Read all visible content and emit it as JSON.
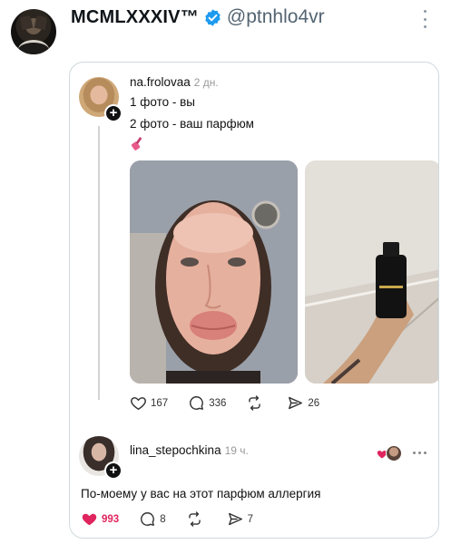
{
  "tweet": {
    "display_name": "MCMLXXXIV™",
    "handle": "@ptnhlo4vr"
  },
  "post": {
    "username": "na.frolovaa",
    "time": "2 дн.",
    "lines": [
      "1 фото - вы",
      "2 фото - ваш парфюм"
    ],
    "emoji_icon": "nail-polish-icon",
    "stats": {
      "likes": "167",
      "comments": "336",
      "reposts": "",
      "shares": "26"
    }
  },
  "reply": {
    "username": "lina_stepochkina",
    "time": "19 ч.",
    "text": "По-моему у вас на этот парфюм аллергия",
    "stats": {
      "likes": "993",
      "comments": "8",
      "reposts": "",
      "shares": "7"
    }
  },
  "colors": {
    "verified": "#1d9bf0",
    "like_active": "#e0245e",
    "border": "#cfd9de"
  }
}
